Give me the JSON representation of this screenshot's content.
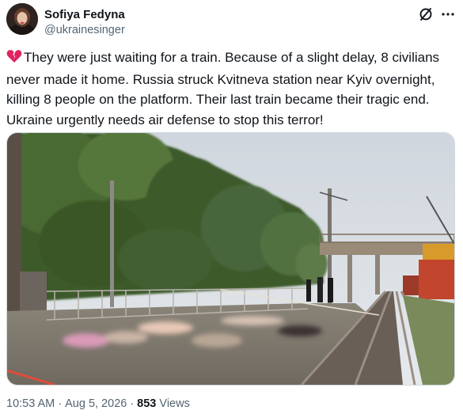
{
  "author": {
    "name": "Sofiya Fedyna",
    "handle": "@ukrainesinger"
  },
  "header_icons": {
    "grok": "grok-slash-icon",
    "more": "more-dots-icon"
  },
  "tweet": {
    "emoji": "broken-heart",
    "text": "They were just waiting for a train. Because of a slight delay, 8 civilians never made it home. Russia struck Kvitneva station near Kyiv overnight, killing 8 people on the platform. Their last train became their tragic end. Ukraine urgently needs air defense to stop this terror!"
  },
  "media": {
    "alt": "Railway platform with blurred bodies after strike"
  },
  "meta": {
    "time": "10:53 AM",
    "date": "Aug 5, 2026",
    "views_count": "853",
    "views_label": "Views"
  },
  "colors": {
    "text": "#0f1419",
    "secondary": "#536471",
    "border": "#cfd9de",
    "broken_heart": "#e0245e"
  }
}
